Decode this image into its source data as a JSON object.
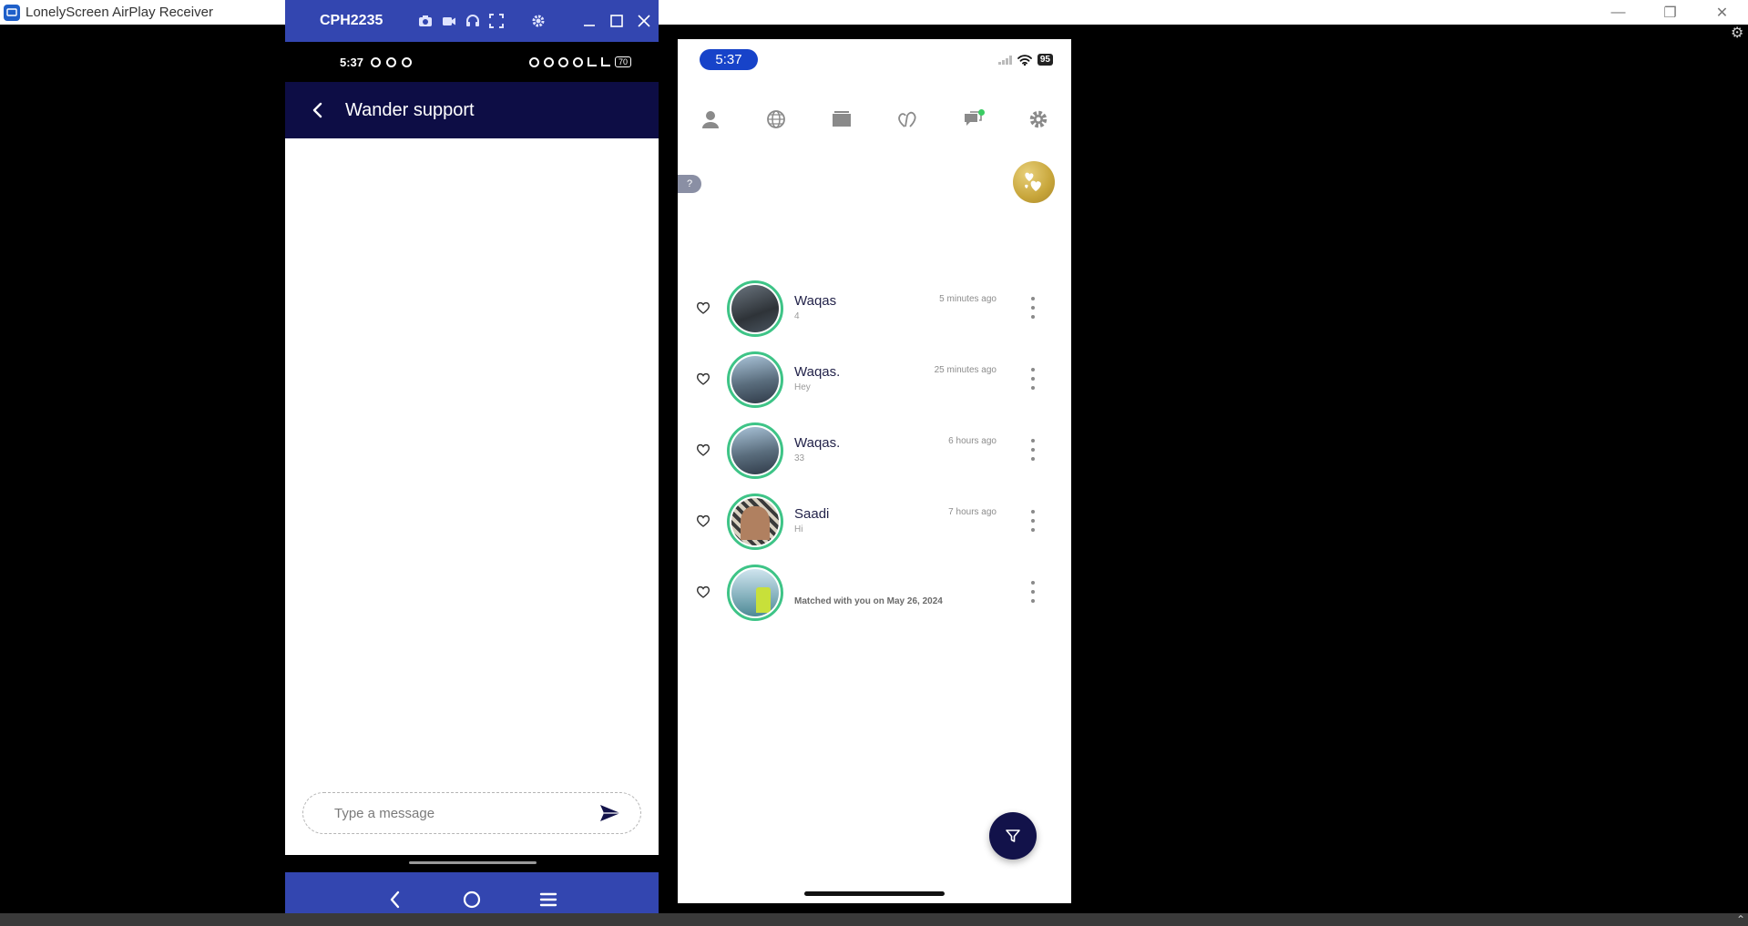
{
  "host": {
    "title": "LonelyScreen AirPlay Receiver",
    "min_glyph": "—",
    "restore_glyph": "❐",
    "close_glyph": "✕",
    "settings_glyph": "⚙",
    "caret_glyph": "⌃"
  },
  "scrcpy": {
    "title": "CPH2235",
    "tools": [
      "camera-icon",
      "video-icon",
      "headphones-icon",
      "fullscreen-icon",
      "gear-icon"
    ],
    "window_controls": [
      "minimize-icon",
      "maximize-icon",
      "close-icon"
    ]
  },
  "android": {
    "status_time": "5:37",
    "battery": "70",
    "header_title": "Wander support",
    "input_placeholder": "Type a message"
  },
  "ios": {
    "status_time": "5:37",
    "battery": "95",
    "help_glyph": "?",
    "tabs": [
      "profile-icon",
      "globe-icon",
      "cards-icon",
      "matches-icon",
      "chat-icon",
      "gear-icon"
    ],
    "matches": [
      {
        "name": "Waqas",
        "sub": "4",
        "time": "5 minutes ago",
        "avatar_color": "#4a5560"
      },
      {
        "name": "Waqas.",
        "sub": "Hey",
        "time": "25 minutes ago",
        "avatar_color": "#5a6d7d"
      },
      {
        "name": "Waqas.",
        "sub": "33",
        "time": "6 hours ago",
        "avatar_color": "#5a6d7d"
      },
      {
        "name": "Saadi",
        "sub": "Hi",
        "time": "7 hours ago",
        "avatar_color": "#7a5a40"
      },
      {
        "name": "",
        "sub": "",
        "time": "",
        "matched": "Matched with you on  May 26, 2024",
        "avatar_color": "#8fb8c4"
      }
    ]
  },
  "colors": {
    "android_header": "#0d0d45",
    "android_chrome": "#3346b0",
    "avatar_ring": "#3ec487",
    "ios_time_pill": "#1743c9",
    "filter_button": "#12124a"
  }
}
